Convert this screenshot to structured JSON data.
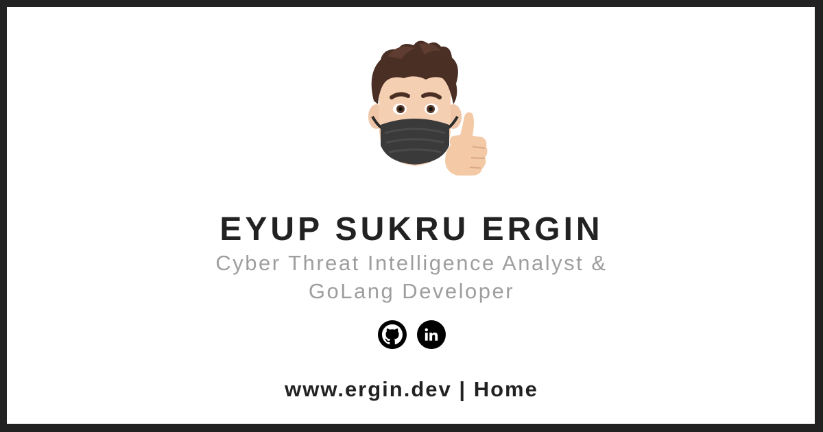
{
  "profile": {
    "name": "EYUP SUKRU ERGIN",
    "subtitle_line1": "Cyber Threat Intelligence Analyst &",
    "subtitle_line2": "GoLang Developer"
  },
  "socials": [
    {
      "icon": "github-icon"
    },
    {
      "icon": "linkedin-icon"
    }
  ],
  "footer": {
    "site": "www.ergin.dev",
    "separator": "|",
    "home": "Home"
  },
  "colors": {
    "frame": "#222222",
    "background": "#ffffff",
    "name": "#222222",
    "subtitle": "#9e9e9e",
    "icons": "#000000"
  }
}
